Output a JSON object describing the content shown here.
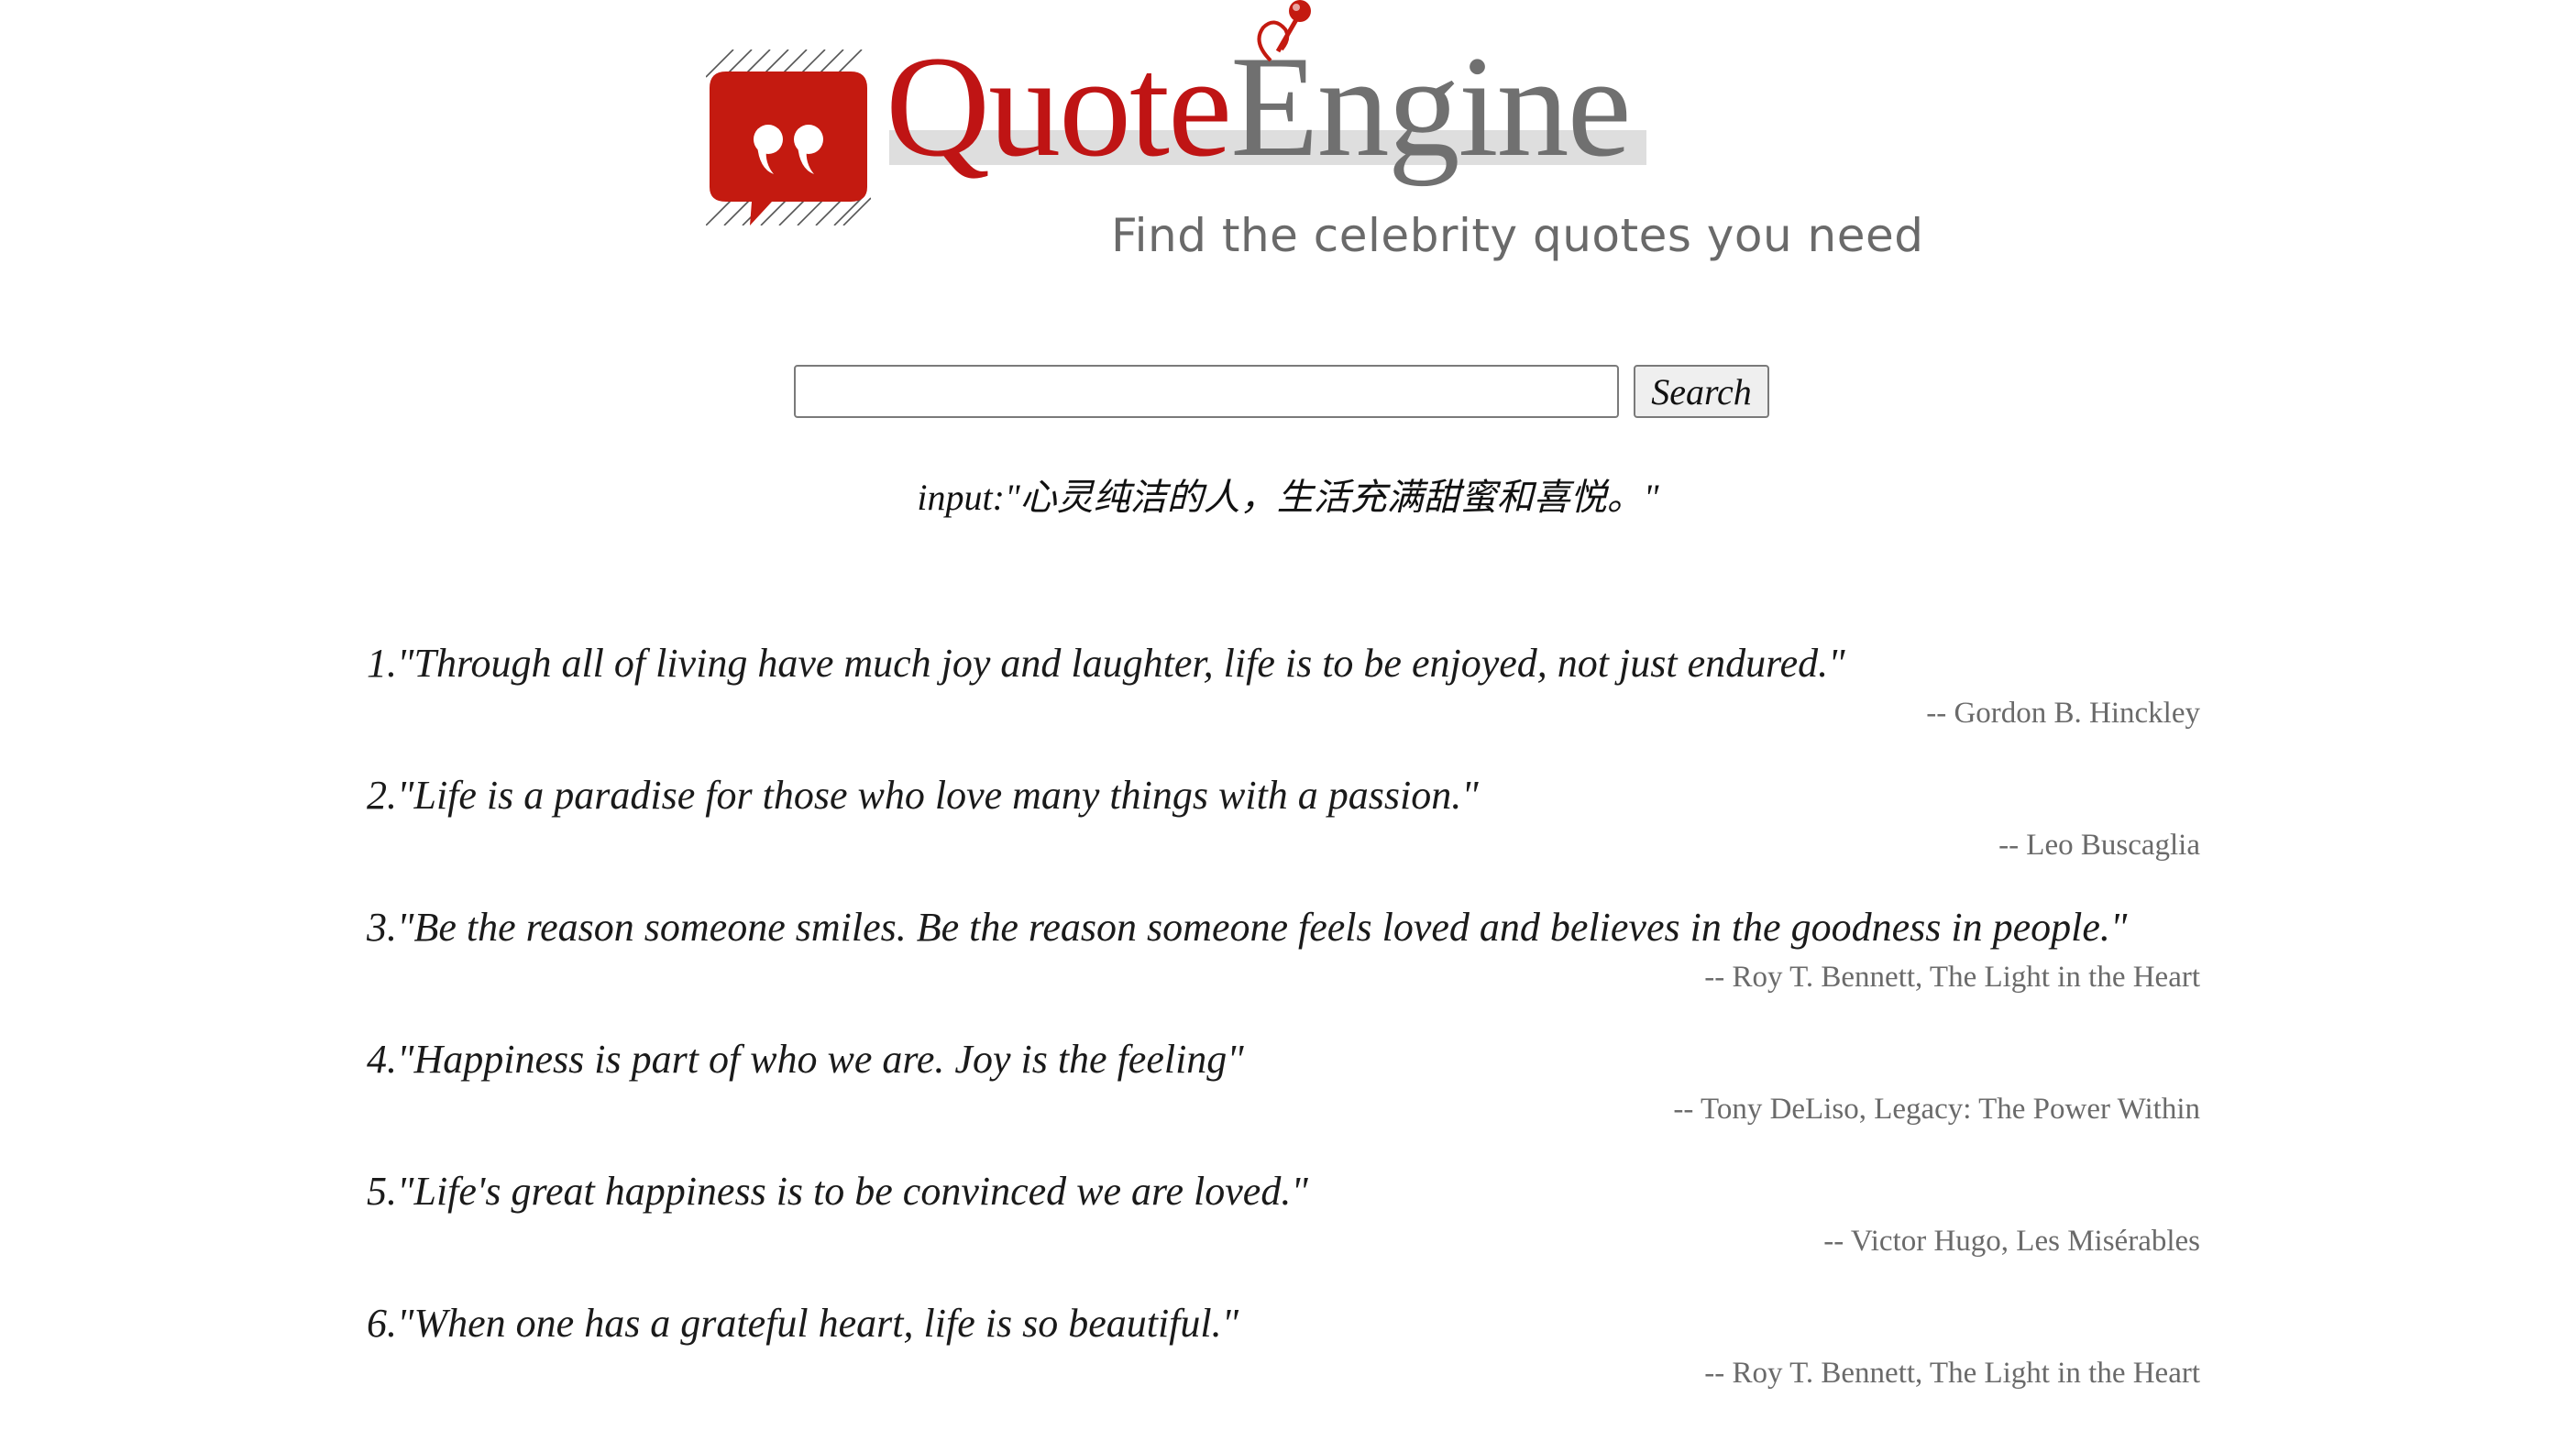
{
  "header": {
    "logo": {
      "word_part1": "Quote",
      "word_part2": "Engine",
      "icon_glyph": "99"
    },
    "tagline": "Find the celebrity quotes you need"
  },
  "search": {
    "input_value": "",
    "button_label": "Search"
  },
  "input_echo": "input:\"心灵纯洁的人，生活充满甜蜜和喜悦。\"",
  "results": [
    {
      "number": "1.",
      "text": "\"Through all of living have much joy and laughter, life is to be enjoyed, not just endured.\"",
      "author": "-- Gordon B. Hinckley"
    },
    {
      "number": "2.",
      "text": "\"Life is a paradise for those who love many things with a passion.\"",
      "author": "-- Leo Buscaglia"
    },
    {
      "number": "3.",
      "text": "\"Be the reason someone smiles. Be the reason someone feels loved and believes in the goodness in people.\"",
      "author": "-- Roy T. Bennett, The Light in the Heart"
    },
    {
      "number": "4.",
      "text": "\"Happiness is part of who we are. Joy is the feeling\"",
      "author": "-- Tony DeLiso, Legacy: The Power Within"
    },
    {
      "number": "5.",
      "text": "\"Life's great happiness is to be convinced we are loved.\"",
      "author": "-- Victor Hugo, Les Misérables"
    },
    {
      "number": "6.",
      "text": "\"When one has a grateful heart, life is so beautiful.\"",
      "author": "-- Roy T. Bennett, The Light in the Heart"
    }
  ],
  "colors": {
    "brand_red": "#bf1414",
    "brand_gray": "#707070",
    "tagline_gray": "#6a6a6a"
  },
  "icons": {
    "logo_icon": "speech-bubble-quote-icon",
    "pin_icon": "pushpin-icon"
  }
}
